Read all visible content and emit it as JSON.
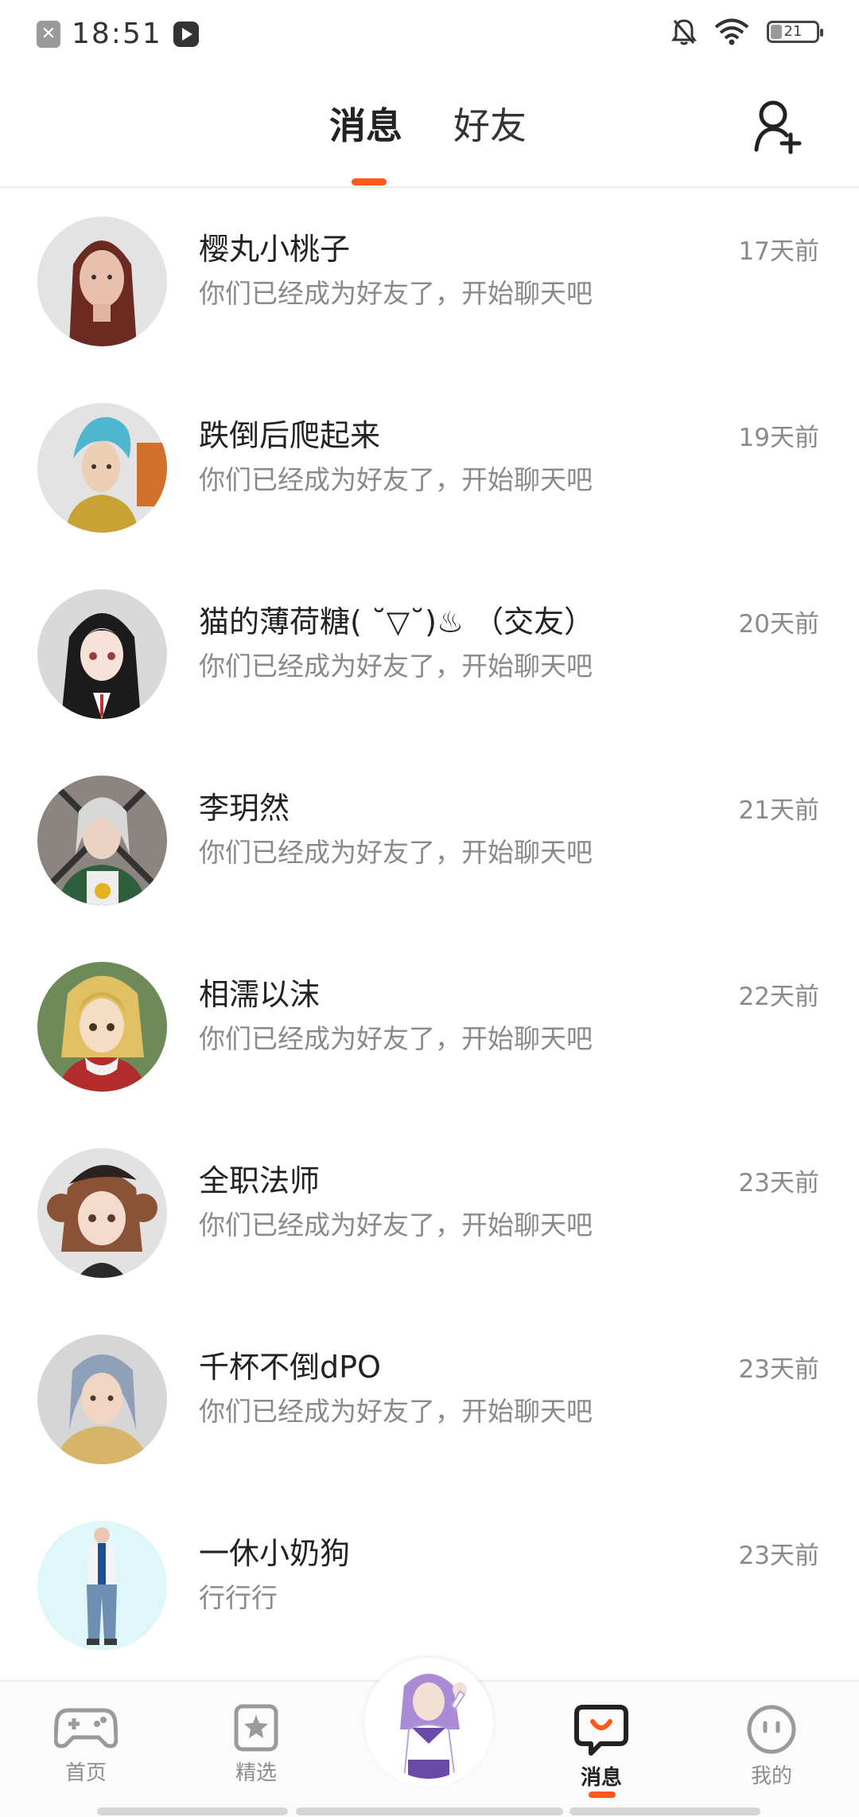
{
  "status_bar": {
    "time": "18:51",
    "battery": "21"
  },
  "header": {
    "tab_messages": "消息",
    "tab_friends": "好友"
  },
  "conversations": [
    {
      "name": "樱丸小桃子",
      "preview": "你们已经成为好友了，开始聊天吧",
      "time": "17天前"
    },
    {
      "name": "跌倒后爬起来",
      "preview": "你们已经成为好友了，开始聊天吧",
      "time": "19天前"
    },
    {
      "name": "猫的薄荷糖( ˘▽˘)♨ （交友）",
      "preview": "你们已经成为好友了，开始聊天吧",
      "time": "20天前"
    },
    {
      "name": "李玥然",
      "preview": "你们已经成为好友了，开始聊天吧",
      "time": "21天前"
    },
    {
      "name": "相濡以沫",
      "preview": "你们已经成为好友了，开始聊天吧",
      "time": "22天前"
    },
    {
      "name": "全职法师",
      "preview": "你们已经成为好友了，开始聊天吧",
      "time": "23天前"
    },
    {
      "name": "千杯不倒dPO",
      "preview": "你们已经成为好友了，开始聊天吧",
      "time": "23天前"
    },
    {
      "name": "一休小奶狗",
      "preview": "行行行",
      "time": "23天前"
    }
  ],
  "bottom_nav": {
    "home": "首页",
    "featured": "精选",
    "messages": "消息",
    "mine": "我的"
  },
  "colors": {
    "accent": "#fa5a1a"
  }
}
